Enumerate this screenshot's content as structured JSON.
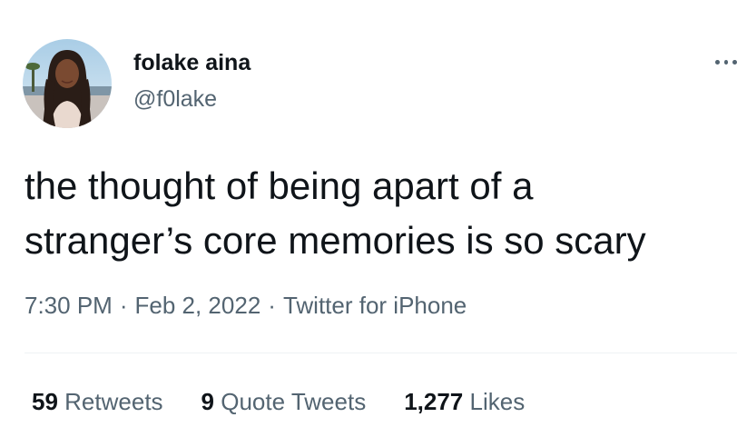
{
  "author": {
    "display_name": "folake aina",
    "handle": "@f0lake",
    "avatar_icon": "profile-photo"
  },
  "tweet": {
    "text_lines": [
      "the thought of being apart of a",
      "stranger’s core memories is so scary"
    ],
    "time": "7:30 PM",
    "separator": "·",
    "date": "Feb 2, 2022",
    "source": "Twitter for iPhone"
  },
  "stats": {
    "retweets_count": "59",
    "retweets_label": "Retweets",
    "quotes_count": "9",
    "quotes_label": "Quote Tweets",
    "likes_count": "1,277",
    "likes_label": "Likes"
  },
  "colors": {
    "text_primary": "#0f1419",
    "text_secondary": "#536471",
    "divider": "#eff3f4"
  }
}
